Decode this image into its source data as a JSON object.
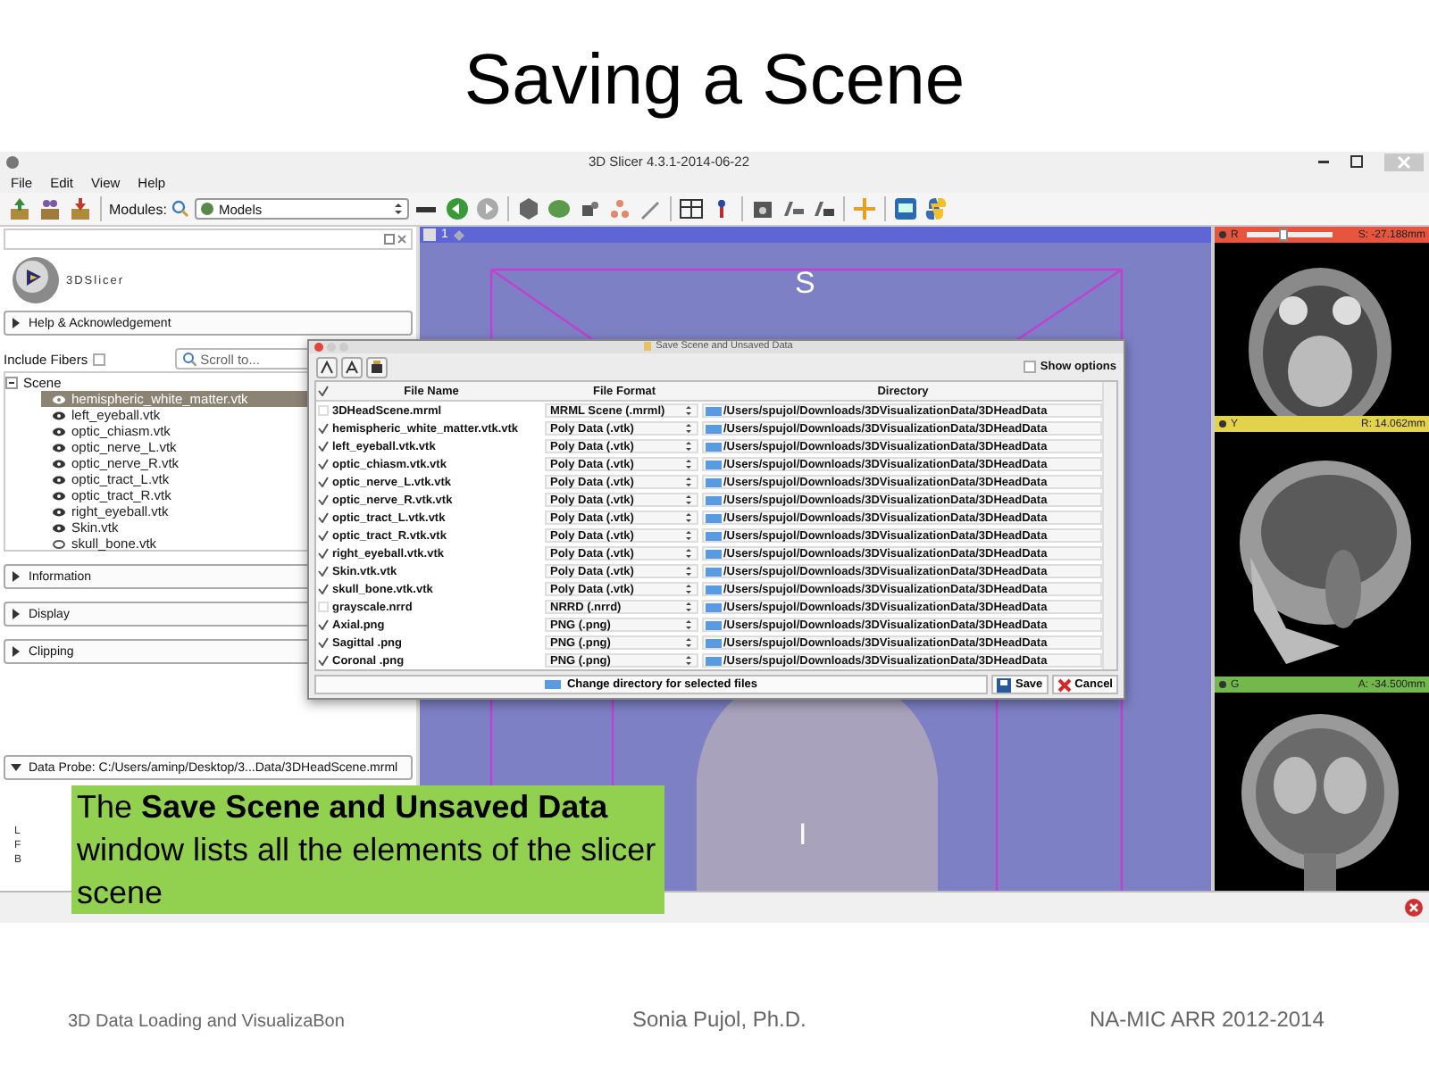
{
  "slide": {
    "title": "Saving a Scene"
  },
  "window": {
    "title": "3D Slicer 4.3.1-2014-06-22"
  },
  "menu": [
    "File",
    "Edit",
    "View",
    "Help"
  ],
  "toolbar": {
    "modules_label": "Modules:",
    "module": "Models"
  },
  "module_panel": {
    "logo_text": "3DSlicer",
    "help_section": {
      "label": "Help & Acknowledgement",
      "expanded": false
    },
    "include_fibers": {
      "label": "Include Fibers",
      "checked": false
    },
    "scroll_placeholder": "Scroll to...",
    "tree": {
      "label": "Scene",
      "expanded": true,
      "children": [
        {
          "label": "hemispheric_white_matter.vtk",
          "visible": true,
          "selected": true
        },
        {
          "label": "left_eyeball.vtk",
          "visible": true,
          "selected": false
        },
        {
          "label": "optic_chiasm.vtk",
          "visible": true,
          "selected": false
        },
        {
          "label": "optic_nerve_L.vtk",
          "visible": true,
          "selected": false
        },
        {
          "label": "optic_nerve_R.vtk",
          "visible": true,
          "selected": false
        },
        {
          "label": "optic_tract_L.vtk",
          "visible": true,
          "selected": false
        },
        {
          "label": "optic_tract_R.vtk",
          "visible": true,
          "selected": false
        },
        {
          "label": "right_eyeball.vtk",
          "visible": true,
          "selected": false
        },
        {
          "label": "Skin.vtk",
          "visible": true,
          "selected": false
        },
        {
          "label": "skull_bone.vtk",
          "visible": false,
          "selected": false
        }
      ]
    },
    "sections": [
      {
        "label": "Information",
        "expanded": false
      },
      {
        "label": "Display",
        "expanded": false
      },
      {
        "label": "Clipping",
        "expanded": false
      }
    ],
    "data_probe": {
      "label": "Data Probe: C:/Users/aminp/Desktop/3...Data/3DHeadScene.mrml",
      "expanded": true
    },
    "orientation_labels": [
      "L",
      "F",
      "B"
    ]
  },
  "view_3d": {
    "layout_number": "1",
    "top_label": "S",
    "bottom_label": "I"
  },
  "slice_views": [
    {
      "label": "R",
      "color": "#e8553f",
      "reading": "S: -27.188mm",
      "level": 0.4
    },
    {
      "label": "Y",
      "color": "#e3d24c",
      "reading": "R: 14.062mm"
    },
    {
      "label": "G",
      "color": "#72b84c",
      "reading": "A: -34.500mm"
    }
  ],
  "dialog": {
    "title": "Save Scene and Unsaved Data",
    "show_options": {
      "label": "Show options",
      "checked": false
    },
    "columns": [
      "File Name",
      "File Format",
      "Directory"
    ],
    "all_checked": true,
    "rows": [
      {
        "checked": false,
        "name": "3DHeadScene.mrml",
        "format": "MRML Scene (.mrml)",
        "directory": "/Users/spujol/Downloads/3DVisualizationData/3DHeadData"
      },
      {
        "checked": true,
        "name": "hemispheric_white_matter.vtk.vtk",
        "format": "Poly Data (.vtk)",
        "directory": "/Users/spujol/Downloads/3DVisualizationData/3DHeadData"
      },
      {
        "checked": true,
        "name": "left_eyeball.vtk.vtk",
        "format": "Poly Data (.vtk)",
        "directory": "/Users/spujol/Downloads/3DVisualizationData/3DHeadData"
      },
      {
        "checked": true,
        "name": "optic_chiasm.vtk.vtk",
        "format": "Poly Data (.vtk)",
        "directory": "/Users/spujol/Downloads/3DVisualizationData/3DHeadData"
      },
      {
        "checked": true,
        "name": "optic_nerve_L.vtk.vtk",
        "format": "Poly Data (.vtk)",
        "directory": "/Users/spujol/Downloads/3DVisualizationData/3DHeadData"
      },
      {
        "checked": true,
        "name": "optic_nerve_R.vtk.vtk",
        "format": "Poly Data (.vtk)",
        "directory": "/Users/spujol/Downloads/3DVisualizationData/3DHeadData"
      },
      {
        "checked": true,
        "name": "optic_tract_L.vtk.vtk",
        "format": "Poly Data (.vtk)",
        "directory": "/Users/spujol/Downloads/3DVisualizationData/3DHeadData"
      },
      {
        "checked": true,
        "name": "optic_tract_R.vtk.vtk",
        "format": "Poly Data (.vtk)",
        "directory": "/Users/spujol/Downloads/3DVisualizationData/3DHeadData"
      },
      {
        "checked": true,
        "name": "right_eyeball.vtk.vtk",
        "format": "Poly Data (.vtk)",
        "directory": "/Users/spujol/Downloads/3DVisualizationData/3DHeadData"
      },
      {
        "checked": true,
        "name": "Skin.vtk.vtk",
        "format": "Poly Data (.vtk)",
        "directory": "/Users/spujol/Downloads/3DVisualizationData/3DHeadData"
      },
      {
        "checked": true,
        "name": "skull_bone.vtk.vtk",
        "format": "Poly Data (.vtk)",
        "directory": "/Users/spujol/Downloads/3DVisualizationData/3DHeadData"
      },
      {
        "checked": false,
        "name": "grayscale.nrrd",
        "format": "NRRD (.nrrd)",
        "directory": "/Users/spujol/Downloads/3DVisualizationData/3DHeadData"
      },
      {
        "checked": true,
        "name": "Axial.png",
        "format": "PNG (.png)",
        "directory": "/Users/spujol/Downloads/3DVisualizationData/3DHeadData"
      },
      {
        "checked": true,
        "name": "Sagittal .png",
        "format": "PNG (.png)",
        "directory": "/Users/spujol/Downloads/3DVisualizationData/3DHeadData"
      },
      {
        "checked": true,
        "name": "Coronal .png",
        "format": "PNG (.png)",
        "directory": "/Users/spujol/Downloads/3DVisualizationData/3DHeadData"
      }
    ],
    "change_directory": "Change directory for selected files",
    "buttons": [
      {
        "kind": "save",
        "label": "Save"
      },
      {
        "kind": "cancel",
        "label": "Cancel"
      }
    ]
  },
  "callout": {
    "text": "The **Save Scene and Unsaved Data** window lists all the elements of the slicer scene"
  },
  "footer": [
    "3D Data Loading and VisualizaBon",
    "Sonia Pujol, Ph.D.",
    "NA-MIC ARR 2012-2014"
  ]
}
